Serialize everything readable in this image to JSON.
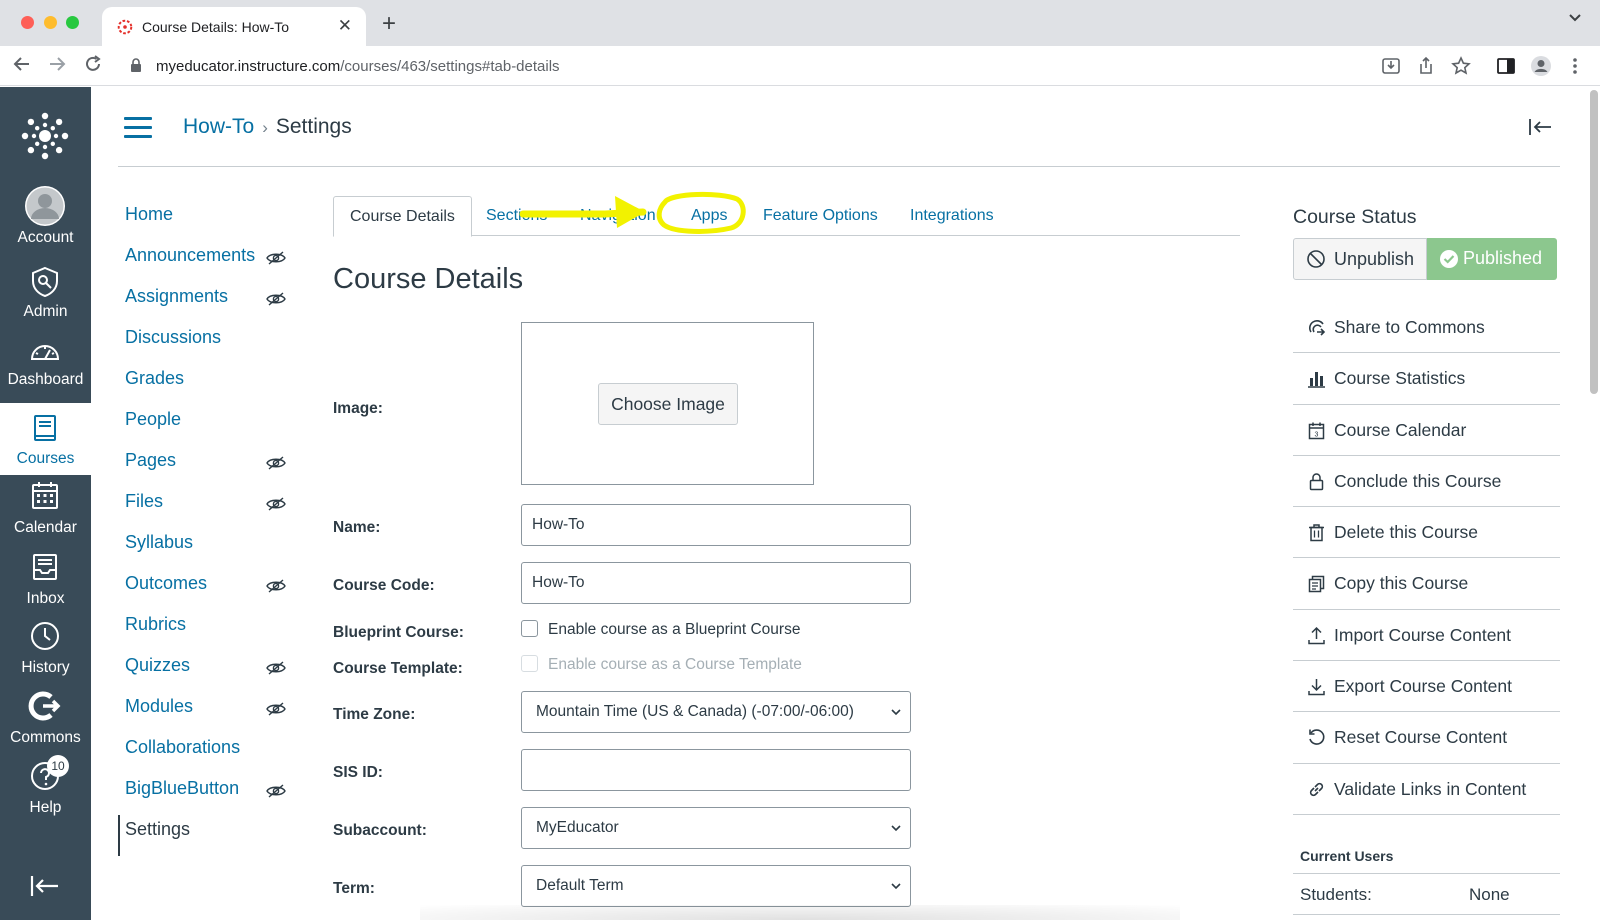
{
  "browser": {
    "tab_title": "Course Details: How-To",
    "new_tab": "+",
    "tab_close": "✕",
    "url_host": "myeducator.instructure.com",
    "url_path": "/courses/463/settings#tab-details"
  },
  "global_nav": {
    "items": [
      {
        "label": "Account",
        "icon": "account-icon"
      },
      {
        "label": "Admin",
        "icon": "admin-shield-icon"
      },
      {
        "label": "Dashboard",
        "icon": "dashboard-icon"
      },
      {
        "label": "Courses",
        "icon": "courses-book-icon",
        "active": true
      },
      {
        "label": "Calendar",
        "icon": "calendar-icon"
      },
      {
        "label": "Inbox",
        "icon": "inbox-icon"
      },
      {
        "label": "History",
        "icon": "history-clock-icon"
      },
      {
        "label": "Commons",
        "icon": "commons-icon"
      },
      {
        "label": "Help",
        "icon": "help-icon",
        "badge": "10"
      }
    ],
    "active_color": "#0770a3",
    "background": "#394b58"
  },
  "header": {
    "course_link": "How-To",
    "separator": "›",
    "current": "Settings"
  },
  "course_nav": {
    "items": [
      {
        "label": "Home",
        "hidden": false
      },
      {
        "label": "Announcements",
        "hidden": true
      },
      {
        "label": "Assignments",
        "hidden": true
      },
      {
        "label": "Discussions",
        "hidden": false
      },
      {
        "label": "Grades",
        "hidden": false
      },
      {
        "label": "People",
        "hidden": false
      },
      {
        "label": "Pages",
        "hidden": true
      },
      {
        "label": "Files",
        "hidden": true
      },
      {
        "label": "Syllabus",
        "hidden": false
      },
      {
        "label": "Outcomes",
        "hidden": true
      },
      {
        "label": "Rubrics",
        "hidden": false
      },
      {
        "label": "Quizzes",
        "hidden": true
      },
      {
        "label": "Modules",
        "hidden": true
      },
      {
        "label": "Collaborations",
        "hidden": false
      },
      {
        "label": "BigBlueButton",
        "hidden": true
      },
      {
        "label": "Settings",
        "hidden": false,
        "active": true
      }
    ]
  },
  "tabs": {
    "items": [
      "Course Details",
      "Sections",
      "Navigation",
      "Apps",
      "Feature Options",
      "Integrations"
    ],
    "active": "Course Details",
    "annotation_color": "#ffff00"
  },
  "form": {
    "title": "Course Details",
    "image_label": "Image:",
    "choose_image": "Choose Image",
    "name_label": "Name:",
    "name_value": "How-To",
    "code_label": "Course Code:",
    "code_value": "How-To",
    "blueprint_label": "Blueprint Course:",
    "blueprint_text": "Enable course as a Blueprint Course",
    "template_label": "Course Template:",
    "template_text": "Enable course as a Course Template",
    "timezone_label": "Time Zone:",
    "timezone_value": "Mountain Time (US & Canada) (-07:00/-06:00)",
    "sis_label": "SIS ID:",
    "sis_value": "",
    "subaccount_label": "Subaccount:",
    "subaccount_value": "MyEducator",
    "term_label": "Term:",
    "term_value": "Default Term"
  },
  "sidebar": {
    "status_title": "Course Status",
    "unpublish": "Unpublish",
    "published": "Published",
    "published_color": "#8cc78e",
    "actions": [
      {
        "label": "Share to Commons",
        "icon": "share-commons-icon"
      },
      {
        "label": "Course Statistics",
        "icon": "bar-chart-icon"
      },
      {
        "label": "Course Calendar",
        "icon": "calendar-icon"
      },
      {
        "label": "Conclude this Course",
        "icon": "lock-icon"
      },
      {
        "label": "Delete this Course",
        "icon": "trash-icon"
      },
      {
        "label": "Copy this Course",
        "icon": "copy-icon"
      },
      {
        "label": "Import Course Content",
        "icon": "upload-icon"
      },
      {
        "label": "Export Course Content",
        "icon": "download-icon"
      },
      {
        "label": "Reset Course Content",
        "icon": "reset-icon"
      },
      {
        "label": "Validate Links in Content",
        "icon": "link-icon"
      }
    ],
    "current_users_title": "Current Users",
    "students_label": "Students:",
    "students_value": "None"
  }
}
